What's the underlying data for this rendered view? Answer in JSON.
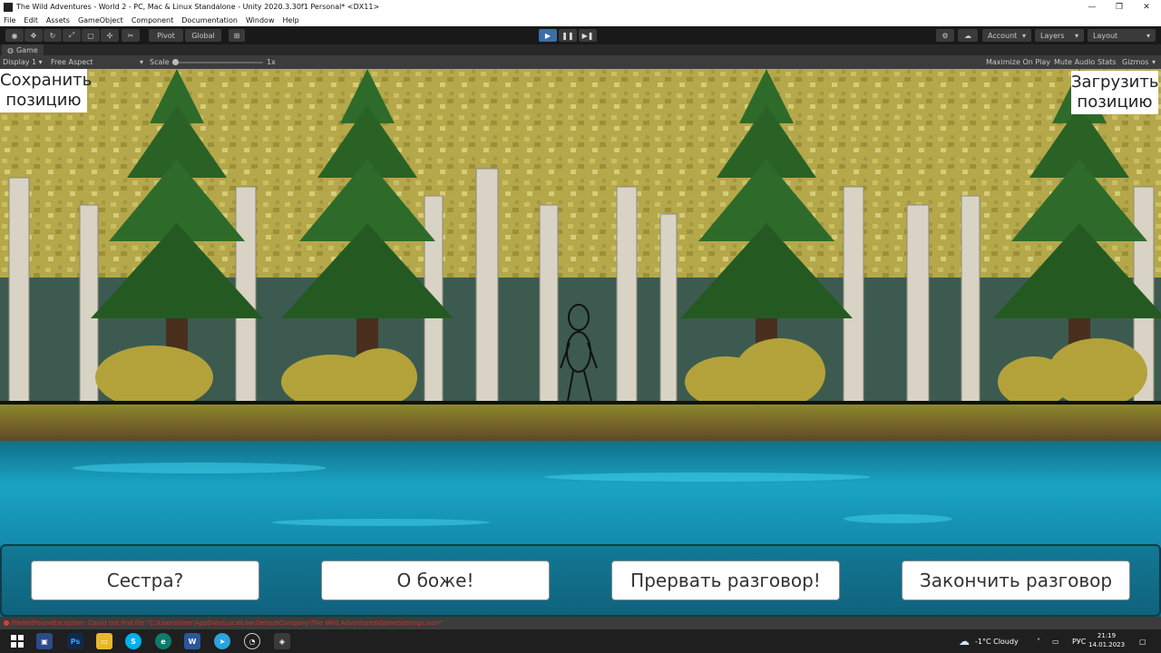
{
  "window": {
    "title": "The Wild Adventures - World 2 - PC, Mac & Linux Standalone - Unity 2020.3.30f1 Personal* <DX11>",
    "minimize": "—",
    "maximize": "❐",
    "close": "✕"
  },
  "menu": [
    "File",
    "Edit",
    "Assets",
    "GameObject",
    "Component",
    "Documentation",
    "Window",
    "Help"
  ],
  "toolbar": {
    "pivot": "Pivot",
    "global": "Global",
    "account": "Account",
    "layers": "Layers",
    "layout": "Layout"
  },
  "game_tab": {
    "label": "Game",
    "display": "Display 1",
    "aspect": "Free Aspect",
    "scale_label": "Scale",
    "scale_value": "1x",
    "maximize_on_play": "Maximize On Play",
    "mute_audio": "Mute Audio",
    "stats": "Stats",
    "gizmos": "Gizmos"
  },
  "game": {
    "save_button": [
      "Сохранить",
      "позицию"
    ],
    "load_button": [
      "Загрузить",
      "позицию"
    ],
    "dialog_options": [
      "Сестра?",
      "О боже!",
      "Прервать разговор!",
      "Закончить разговор"
    ],
    "colors": {
      "water": "#1aa3c4",
      "grass": "#8c8a2a",
      "pine": "#2e6b2a",
      "foliage": "#b5a84a"
    }
  },
  "console": {
    "message": "FileNotFoundException: Could not find file \"C:\\Users\\User\\AppData\\LocalLow\\DefaultCompany\\The Wild Adventures\\GameSettings.json\""
  },
  "taskbar": {
    "weather": "-1°C  Cloudy",
    "lang": "РУС",
    "time": "21:19",
    "date": "14.01.2023"
  }
}
